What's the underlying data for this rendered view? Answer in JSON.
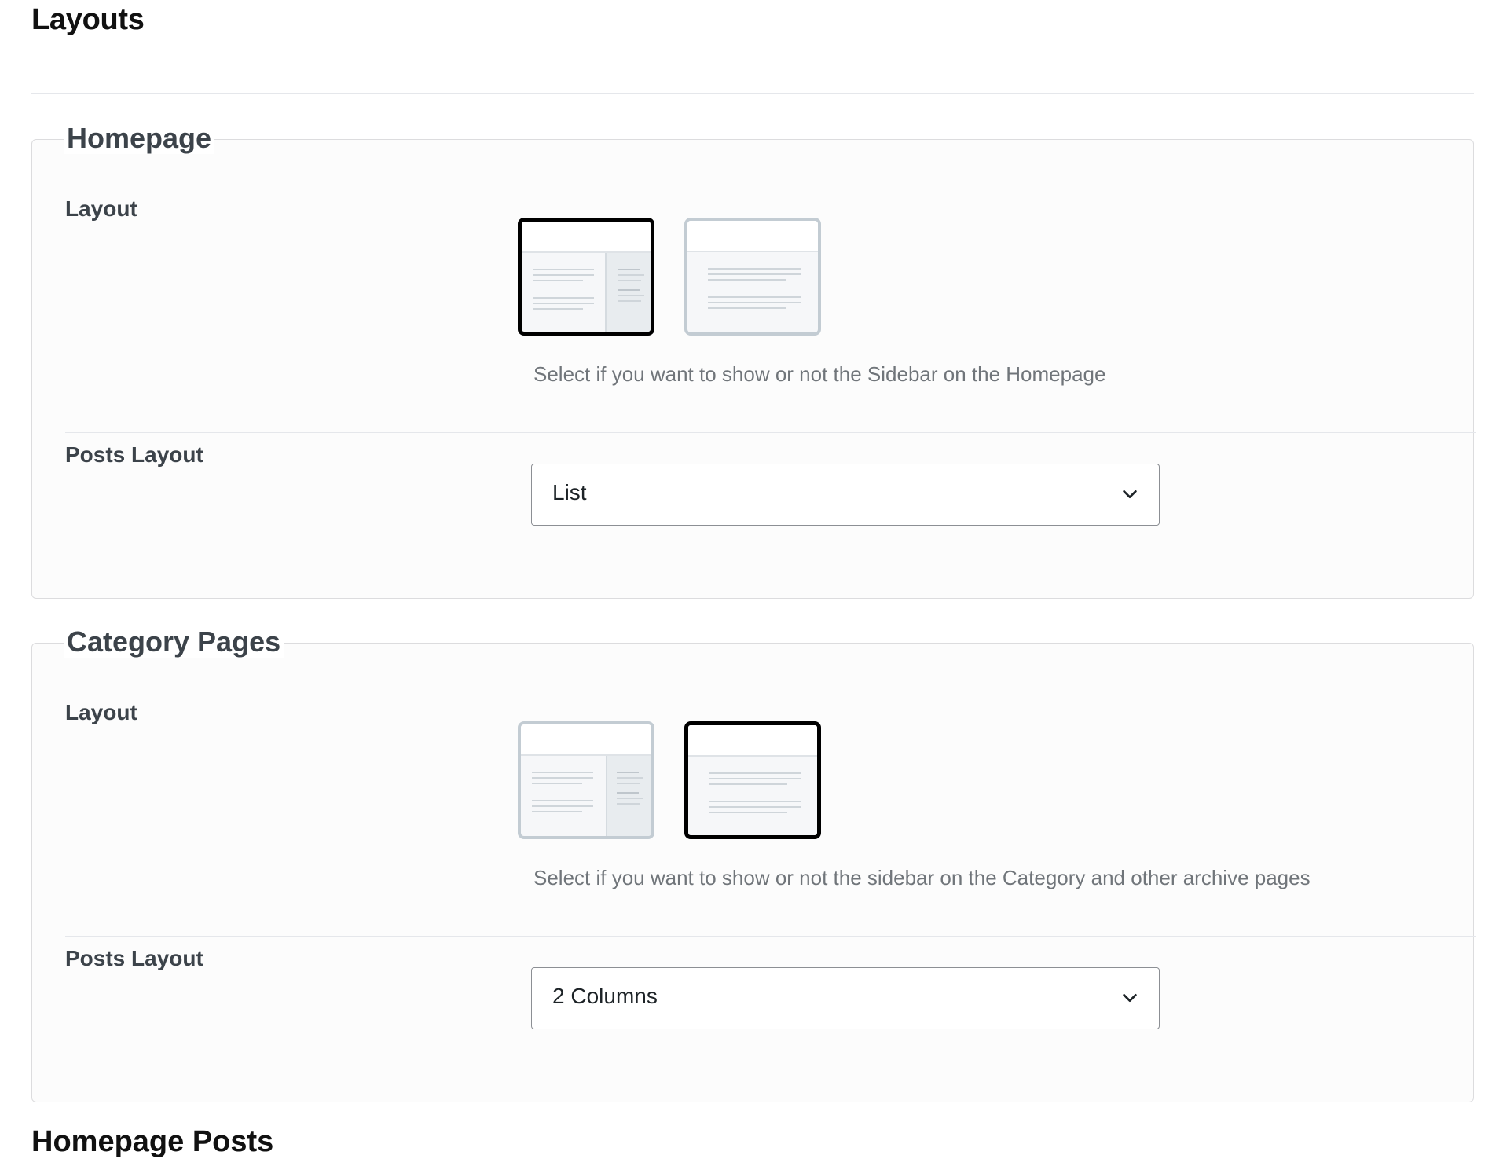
{
  "page": {
    "title": "Layouts",
    "next_heading": "Homepage Posts"
  },
  "sections": [
    {
      "legend": "Homepage",
      "layout_label": "Layout",
      "layout_options": [
        {
          "name": "with-sidebar",
          "selected": true
        },
        {
          "name": "no-sidebar",
          "selected": false
        }
      ],
      "layout_help": "Select if you want to show or not the Sidebar on the Homepage",
      "posts_layout_label": "Posts Layout",
      "posts_layout_value": "List"
    },
    {
      "legend": "Category Pages",
      "layout_label": "Layout",
      "layout_options": [
        {
          "name": "with-sidebar",
          "selected": false
        },
        {
          "name": "no-sidebar",
          "selected": true
        }
      ],
      "layout_help": "Select if you want to show or not the sidebar on the Category and other archive pages",
      "posts_layout_label": "Posts Layout",
      "posts_layout_value": "2 Columns"
    }
  ],
  "colors": {
    "selected_border": "#000000",
    "unselected_border": "#c3ccd3",
    "section_border": "#dcdcde",
    "label_text": "#3c434a",
    "help_text": "#70757a"
  }
}
